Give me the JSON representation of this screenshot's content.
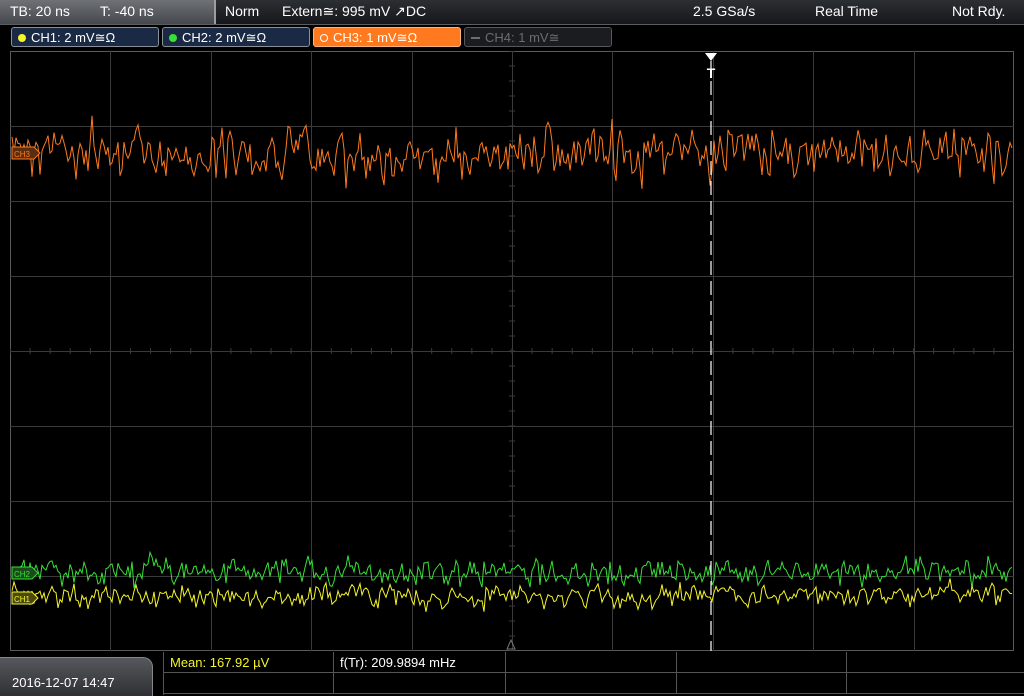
{
  "topbar": {
    "timebase": "TB: 20 ns",
    "trigger_offset": "T: -40 ns",
    "trigger_mode": "Norm",
    "trigger_source": "Extern≅: 995 mV ↗DC",
    "sample_rate": "2.5 GSa/s",
    "acq_mode": "Real Time",
    "status": "Not Rdy."
  },
  "channels": [
    {
      "label": "CH1: 2 mV≅Ω",
      "color": "#f5f52a",
      "active": true
    },
    {
      "label": "CH2: 2 mV≅Ω",
      "color": "#37e037",
      "active": true
    },
    {
      "label": "CH3: 1 mV≅Ω",
      "color": "#ff7a1e",
      "active": true,
      "selected": true
    },
    {
      "label": "CH4: 1 mV≅",
      "color": "#6a6d71",
      "active": false
    }
  ],
  "markers": {
    "ch3": "CH3",
    "ch2": "CH2",
    "ch1": "CH1",
    "trigger": "T"
  },
  "bottombar": {
    "datetime": "2016-12-07 14:47",
    "mean": "Mean: 167.92 µV",
    "freq": "f(Tr): 209.9894 mHz"
  },
  "colors": {
    "grid": "#3a3a3a",
    "ch1": "#f5f52a",
    "ch2": "#37e037",
    "ch3": "#ff7a1e"
  }
}
